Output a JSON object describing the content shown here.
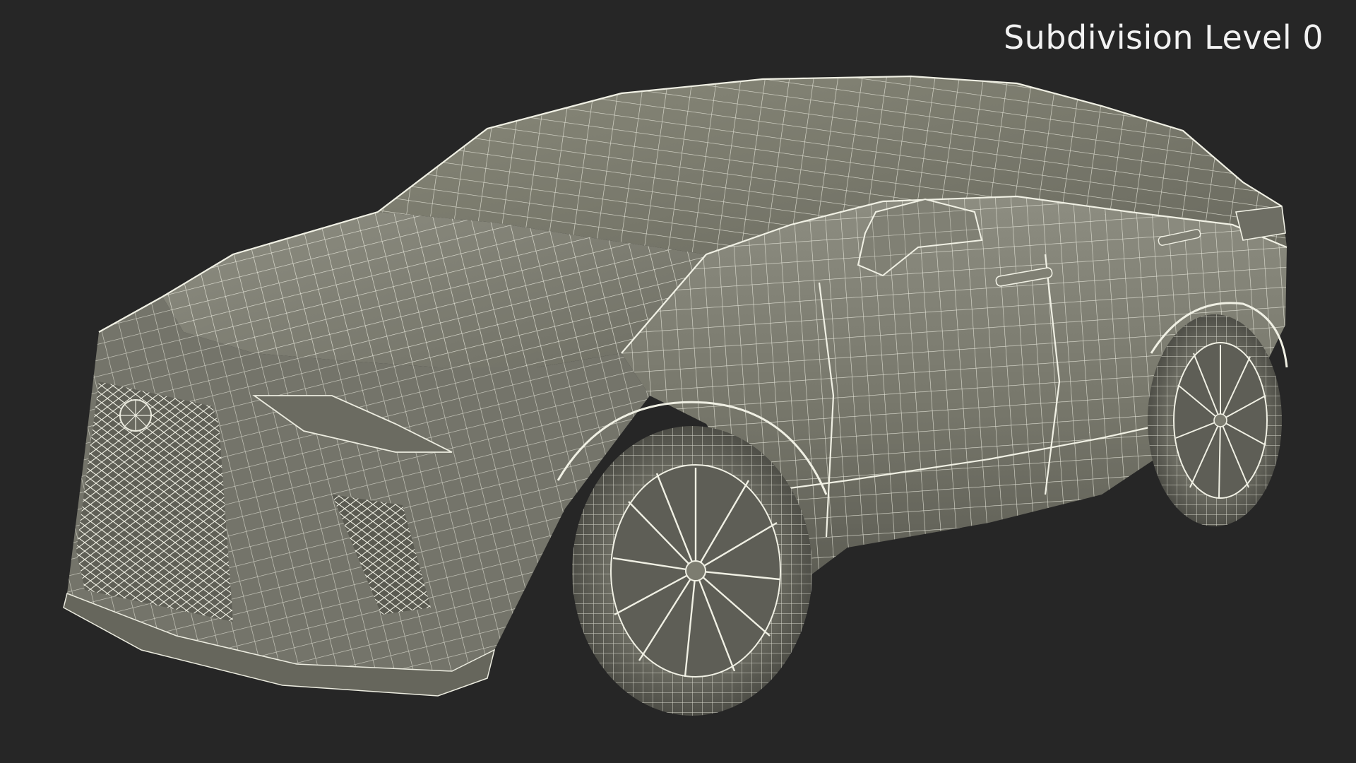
{
  "render": {
    "label": "Subdivision Level 0",
    "background_color": "#262626",
    "surface_color": "#7c7c70",
    "wire_color": "#eeeee2",
    "subject": "car-wireframe"
  }
}
